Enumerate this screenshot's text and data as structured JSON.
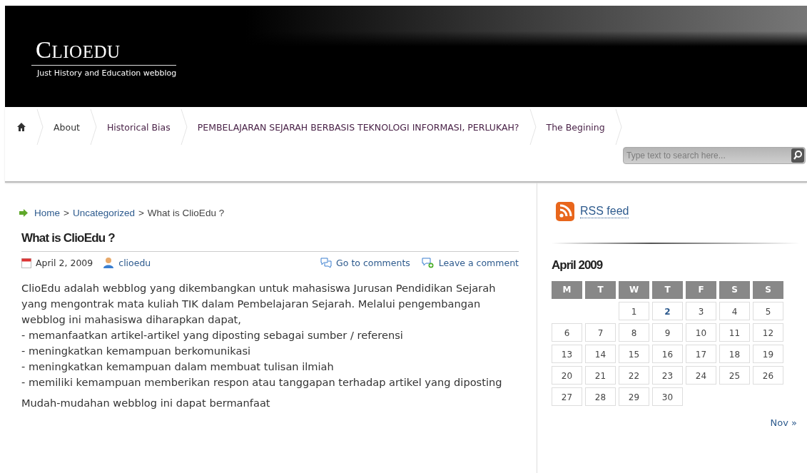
{
  "header": {
    "title": "CLIOEDU",
    "tagline": "Just History and Education webblog"
  },
  "nav": {
    "items": [
      {
        "label": "About",
        "visited": false
      },
      {
        "label": "Historical Bias",
        "visited": true
      },
      {
        "label": "PEMBELAJARAN SEJARAH BERBASIS TEKNOLOGI INFORMASI, PERLUKAH?",
        "visited": true
      },
      {
        "label": "The Begining",
        "visited": true
      }
    ],
    "search": {
      "placeholder": "Type text to search here..."
    }
  },
  "breadcrumb": [
    {
      "label": "Home",
      "kind": "link"
    },
    {
      "label": ">",
      "kind": "separator"
    },
    {
      "label": "Uncategorized",
      "kind": "link"
    },
    {
      "label": ">",
      "kind": "separator"
    },
    {
      "label": "What is ClioEdu ?",
      "kind": "current"
    }
  ],
  "post": {
    "title": "What is ClioEdu ?",
    "date": "April 2, 2009",
    "author": "clioedu",
    "comments_link": "Go to comments",
    "leave_comment": "Leave a comment",
    "paragraphs": [
      "ClioEdu adalah webblog yang dikembangkan untuk mahasiswa Jurusan Pendidikan Sejarah yang mengontrak mata kuliah TIK dalam Pembelajaran Sejarah. Melalui pengembangan webblog ini mahasiswa diharapkan dapat,",
      "- memanfaatkan artikel-artikel yang diposting sebagai sumber / referensi",
      "- meningkatkan kemampuan berkomunikasi",
      "- meningkatkan kemampuan dalam membuat tulisan ilmiah",
      "- memiliki kemampuan memberikan respon atau tanggapan terhadap artikel yang diposting",
      "Mudah-mudahan webblog ini dapat bermanfaat"
    ]
  },
  "sidebar": {
    "rss": "RSS feed",
    "calendar": {
      "title": "April 2009",
      "weekdays": [
        "M",
        "T",
        "W",
        "T",
        "F",
        "S",
        "S"
      ],
      "weeks": [
        {
          "days": [
            {
              "kind": "blank"
            },
            {
              "kind": "blank"
            },
            {
              "kind": "day",
              "day": "1",
              "linked": false
            },
            {
              "kind": "day",
              "day": "2",
              "linked": true
            },
            {
              "kind": "day",
              "day": "3",
              "linked": false
            },
            {
              "kind": "day",
              "day": "4",
              "linked": false
            },
            {
              "kind": "day",
              "day": "5",
              "linked": false
            }
          ]
        },
        {
          "days": [
            {
              "day": "6",
              "linked": false
            },
            {
              "day": "7",
              "linked": false
            },
            {
              "day": "8",
              "linked": false
            },
            {
              "day": "9",
              "linked": false
            },
            {
              "day": "10",
              "linked": false
            },
            {
              "day": "11",
              "linked": false
            },
            {
              "day": "12",
              "linked": false
            }
          ]
        },
        {
          "days": [
            {
              "day": "13",
              "linked": false
            },
            {
              "day": "14",
              "linked": false
            },
            {
              "day": "15",
              "linked": false
            },
            {
              "day": "16",
              "linked": false
            },
            {
              "day": "17",
              "linked": false
            },
            {
              "day": "18",
              "linked": false
            },
            {
              "day": "19",
              "linked": false
            }
          ]
        },
        {
          "days": [
            {
              "day": "20",
              "linked": false
            },
            {
              "day": "21",
              "linked": false
            },
            {
              "day": "22",
              "linked": false
            },
            {
              "day": "23",
              "linked": false
            },
            {
              "day": "24",
              "linked": false
            },
            {
              "day": "25",
              "linked": false
            },
            {
              "day": "26",
              "linked": false
            }
          ]
        },
        {
          "days": [
            {
              "day": "27",
              "linked": false
            },
            {
              "day": "28",
              "linked": false
            },
            {
              "day": "29",
              "linked": false
            },
            {
              "day": "30",
              "linked": false
            }
          ]
        }
      ],
      "next": "Nov »"
    }
  }
}
